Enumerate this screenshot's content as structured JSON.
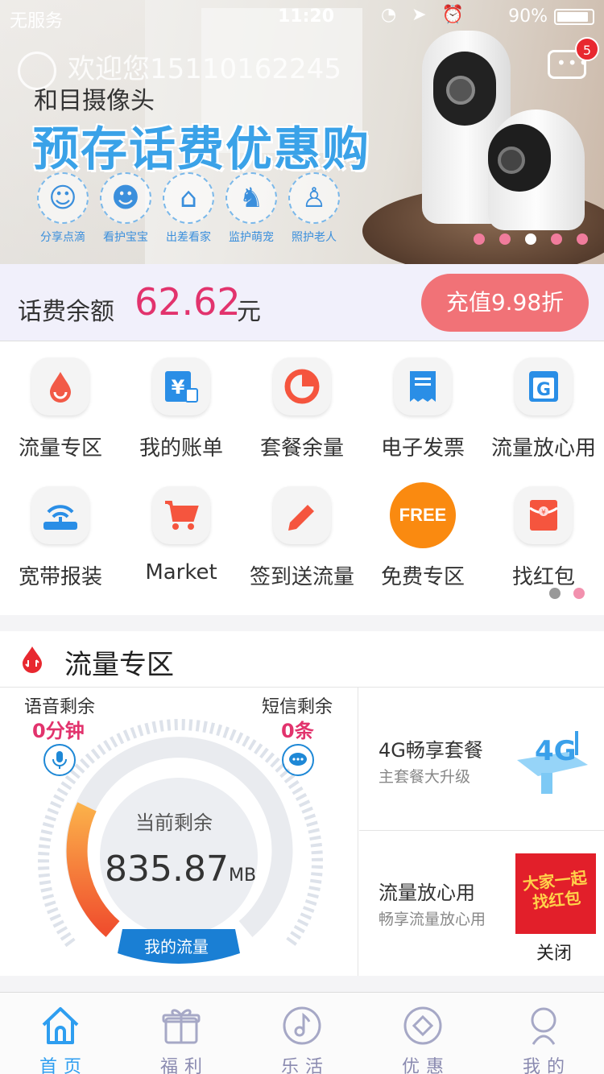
{
  "status_bar": {
    "carrier": "无服务",
    "time": "11:20",
    "battery": "90%"
  },
  "header": {
    "welcome": "欢迎您15110162245",
    "message_badge": "5"
  },
  "banner": {
    "subtitle": "和目摄像头",
    "title": "预存话费优惠购",
    "features": [
      "分享点滴",
      "看护宝宝",
      "出差看家",
      "监护萌宠",
      "照护老人"
    ],
    "slides": 5,
    "active_slide": 3
  },
  "balance": {
    "label": "话费余额",
    "amount": "62.62",
    "unit": "元",
    "recharge_label": "充值9.98折"
  },
  "grid": {
    "items": [
      {
        "label": "流量专区",
        "icon": "drop-icon"
      },
      {
        "label": "我的账单",
        "icon": "bill-icon"
      },
      {
        "label": "套餐余量",
        "icon": "pie-icon"
      },
      {
        "label": "电子发票",
        "icon": "invoice-icon"
      },
      {
        "label": "流量放心用",
        "icon": "g-icon"
      },
      {
        "label": "宽带报装",
        "icon": "router-icon"
      },
      {
        "label": "Market",
        "icon": "cart-icon"
      },
      {
        "label": "签到送流量",
        "icon": "pencil-icon"
      },
      {
        "label": "免费专区",
        "icon": "free-icon",
        "badge_text": "FREE"
      },
      {
        "label": "找红包",
        "icon": "red-envelope-icon"
      }
    ],
    "pages": 2,
    "active_page": 2
  },
  "flow_section": {
    "title": "流量专区",
    "voice_label": "语音剩余",
    "voice_value": "0分钟",
    "sms_label": "短信剩余",
    "sms_value": "0条",
    "remaining_label": "当前剩余",
    "remaining_value": "835.87",
    "remaining_unit": "MB",
    "my_flow_label": "我的流量",
    "cards": [
      {
        "title": "4G畅享套餐",
        "subtitle": "主套餐大升级",
        "art_text": "4G"
      },
      {
        "title": "流量放心用",
        "subtitle": "畅享流量放心用"
      }
    ],
    "popup": {
      "text": "大家一起找红包",
      "close_label": "关闭"
    }
  },
  "tabbar": {
    "tabs": [
      {
        "label": "首页",
        "icon": "home-icon",
        "active": true
      },
      {
        "label": "福利",
        "icon": "gift-icon",
        "active": false
      },
      {
        "label": "乐活",
        "icon": "music-icon",
        "active": false
      },
      {
        "label": "优惠",
        "icon": "discount-icon",
        "active": false
      },
      {
        "label": "我的",
        "icon": "user-icon",
        "active": false
      }
    ]
  },
  "colors": {
    "accent_pink": "#e2336d",
    "recharge_btn": "#f17277",
    "tab_active": "#2e9ef0",
    "gauge_arc": "#f0502e"
  }
}
